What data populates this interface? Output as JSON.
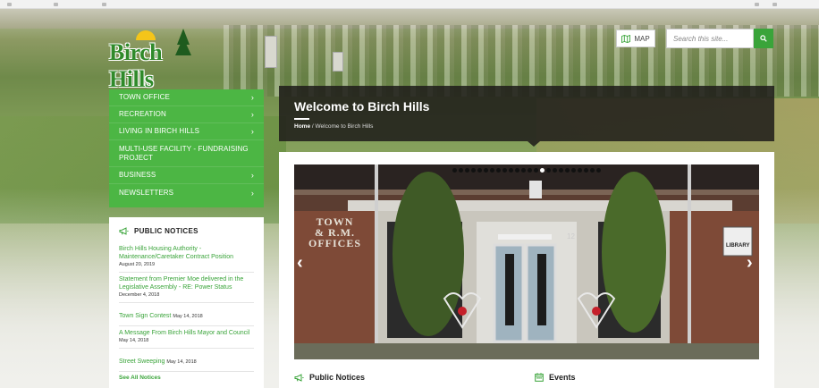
{
  "brand": {
    "logo_text": "Birch Hills",
    "accent_green": "#4cb644",
    "link_green": "#3aa43a"
  },
  "header": {
    "map_label": "MAP",
    "search_placeholder": "Search this site..."
  },
  "nav": {
    "items": [
      {
        "label": "TOWN OFFICE",
        "has_children": true
      },
      {
        "label": "RECREATION",
        "has_children": true
      },
      {
        "label": "LIVING IN BIRCH HILLS",
        "has_children": true
      },
      {
        "label": "MULTI-USE FACILITY - FUNDRAISING PROJECT",
        "has_children": false
      },
      {
        "label": "BUSINESS",
        "has_children": true
      },
      {
        "label": "NEWSLETTERS",
        "has_children": true
      }
    ],
    "chevron": "›"
  },
  "sidebar": {
    "title": "PUBLIC NOTICES",
    "notices": [
      {
        "title": "Birch Hills Housing Authority - Maintenance/Caretaker Contract Position",
        "date": "August 20, 2019"
      },
      {
        "title": "Statement from Premier Moe delivered in the Legislative Assembly - RE: Power Status",
        "date": "December 4, 2018"
      },
      {
        "title": "Town Sign Contest",
        "date": "May 14, 2018"
      },
      {
        "title": "A Message From Birch Hills Mayor and Council",
        "date": "May 14, 2018"
      },
      {
        "title": "Street Sweeping",
        "date": "May 14, 2018"
      }
    ],
    "see_all": "See All Notices"
  },
  "welcome": {
    "title": "Welcome to Birch Hills",
    "breadcrumb_home": "Home",
    "breadcrumb_sep": "/",
    "breadcrumb_current": "Welcome to Birch Hills"
  },
  "slider": {
    "slide_count": 24,
    "active_index": 14,
    "prev_glyph": "‹",
    "next_glyph": "›",
    "sign_text": [
      "TOWN",
      "& R.M.",
      "OFFICES"
    ],
    "library_text": "LIBRARY",
    "address_text": "12"
  },
  "sections": {
    "public_notices": "Public Notices",
    "events": "Events"
  }
}
